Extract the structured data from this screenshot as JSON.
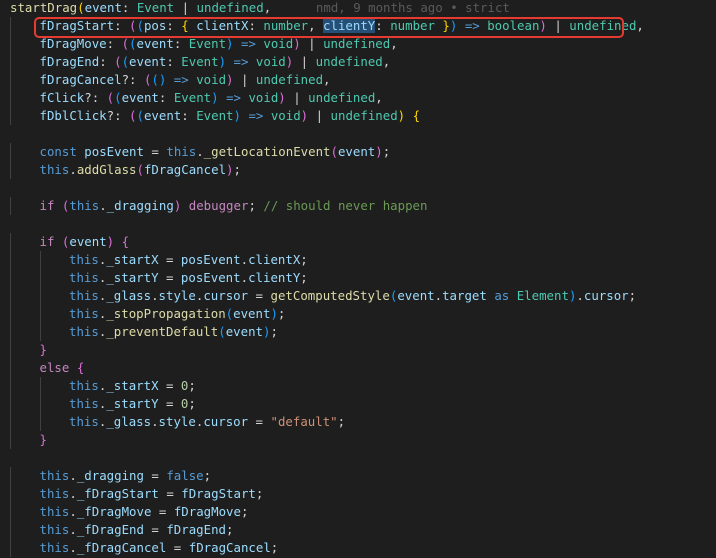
{
  "editor": {
    "lines": [
      {
        "indent": 0,
        "tokens": [
          {
            "t": "startDrag",
            "c": "fn"
          },
          {
            "t": "(",
            "c": "br"
          },
          {
            "t": "event",
            "c": "var"
          },
          {
            "t": ": ",
            "c": "op"
          },
          {
            "t": "Event",
            "c": "ty"
          },
          {
            "t": " | ",
            "c": "op"
          },
          {
            "t": "undefined",
            "c": "ty"
          },
          {
            "t": ",",
            "c": "op"
          },
          {
            "t": "      nmd, 9 months ago • strict",
            "c": "blame"
          }
        ]
      },
      {
        "indent": 1,
        "tokens": [
          {
            "t": "fDragStart",
            "c": "var"
          },
          {
            "t": ": ",
            "c": "op"
          },
          {
            "t": "(",
            "c": "br2"
          },
          {
            "t": "(",
            "c": "br3"
          },
          {
            "t": "pos",
            "c": "var"
          },
          {
            "t": ": ",
            "c": "op"
          },
          {
            "t": "{",
            "c": "br"
          },
          {
            "t": " ",
            "c": "op"
          },
          {
            "t": "clientX",
            "c": "var"
          },
          {
            "t": ": ",
            "c": "op"
          },
          {
            "t": "number",
            "c": "ty"
          },
          {
            "t": ", ",
            "c": "op"
          },
          {
            "t": "clientY",
            "c": "var",
            "hl": true
          },
          {
            "t": ": ",
            "c": "op"
          },
          {
            "t": "number",
            "c": "ty"
          },
          {
            "t": " ",
            "c": "op"
          },
          {
            "t": "}",
            "c": "br"
          },
          {
            "t": ")",
            "c": "br3"
          },
          {
            "t": " => ",
            "c": "kw"
          },
          {
            "t": "boolean",
            "c": "ty"
          },
          {
            "t": ")",
            "c": "br2"
          },
          {
            "t": " | ",
            "c": "op"
          },
          {
            "t": "undefined",
            "c": "ty"
          },
          {
            "t": ",",
            "c": "op"
          }
        ]
      },
      {
        "indent": 1,
        "tokens": [
          {
            "t": "fDragMove",
            "c": "var"
          },
          {
            "t": ": ",
            "c": "op"
          },
          {
            "t": "(",
            "c": "br2"
          },
          {
            "t": "(",
            "c": "br3"
          },
          {
            "t": "event",
            "c": "var"
          },
          {
            "t": ": ",
            "c": "op"
          },
          {
            "t": "Event",
            "c": "ty"
          },
          {
            "t": ")",
            "c": "br3"
          },
          {
            "t": " => ",
            "c": "kw"
          },
          {
            "t": "void",
            "c": "ty"
          },
          {
            "t": ")",
            "c": "br2"
          },
          {
            "t": " | ",
            "c": "op"
          },
          {
            "t": "undefined",
            "c": "ty"
          },
          {
            "t": ",",
            "c": "op"
          }
        ]
      },
      {
        "indent": 1,
        "tokens": [
          {
            "t": "fDragEnd",
            "c": "var"
          },
          {
            "t": ": ",
            "c": "op"
          },
          {
            "t": "(",
            "c": "br2"
          },
          {
            "t": "(",
            "c": "br3"
          },
          {
            "t": "event",
            "c": "var"
          },
          {
            "t": ": ",
            "c": "op"
          },
          {
            "t": "Event",
            "c": "ty"
          },
          {
            "t": ")",
            "c": "br3"
          },
          {
            "t": " => ",
            "c": "kw"
          },
          {
            "t": "void",
            "c": "ty"
          },
          {
            "t": ")",
            "c": "br2"
          },
          {
            "t": " | ",
            "c": "op"
          },
          {
            "t": "undefined",
            "c": "ty"
          },
          {
            "t": ",",
            "c": "op"
          }
        ]
      },
      {
        "indent": 1,
        "tokens": [
          {
            "t": "fDragCancel",
            "c": "var"
          },
          {
            "t": "?: ",
            "c": "op"
          },
          {
            "t": "(",
            "c": "br2"
          },
          {
            "t": "()",
            "c": "br3"
          },
          {
            "t": " => ",
            "c": "kw"
          },
          {
            "t": "void",
            "c": "ty"
          },
          {
            "t": ")",
            "c": "br2"
          },
          {
            "t": " | ",
            "c": "op"
          },
          {
            "t": "undefined",
            "c": "ty"
          },
          {
            "t": ",",
            "c": "op"
          }
        ]
      },
      {
        "indent": 1,
        "tokens": [
          {
            "t": "fClick",
            "c": "var"
          },
          {
            "t": "?: ",
            "c": "op"
          },
          {
            "t": "(",
            "c": "br2"
          },
          {
            "t": "(",
            "c": "br3"
          },
          {
            "t": "event",
            "c": "var"
          },
          {
            "t": ": ",
            "c": "op"
          },
          {
            "t": "Event",
            "c": "ty"
          },
          {
            "t": ")",
            "c": "br3"
          },
          {
            "t": " => ",
            "c": "kw"
          },
          {
            "t": "void",
            "c": "ty"
          },
          {
            "t": ")",
            "c": "br2"
          },
          {
            "t": " | ",
            "c": "op"
          },
          {
            "t": "undefined",
            "c": "ty"
          },
          {
            "t": ",",
            "c": "op"
          }
        ]
      },
      {
        "indent": 1,
        "tokens": [
          {
            "t": "fDblClick",
            "c": "var"
          },
          {
            "t": "?: ",
            "c": "op"
          },
          {
            "t": "(",
            "c": "br2"
          },
          {
            "t": "(",
            "c": "br3"
          },
          {
            "t": "event",
            "c": "var"
          },
          {
            "t": ": ",
            "c": "op"
          },
          {
            "t": "Event",
            "c": "ty"
          },
          {
            "t": ")",
            "c": "br3"
          },
          {
            "t": " => ",
            "c": "kw"
          },
          {
            "t": "void",
            "c": "ty"
          },
          {
            "t": ")",
            "c": "br2"
          },
          {
            "t": " | ",
            "c": "op"
          },
          {
            "t": "undefined",
            "c": "ty"
          },
          {
            "t": ")",
            "c": "br"
          },
          {
            "t": " ",
            "c": "op"
          },
          {
            "t": "{",
            "c": "br"
          }
        ]
      },
      {
        "indent": 0,
        "tokens": []
      },
      {
        "indent": 1,
        "tokens": [
          {
            "t": "const",
            "c": "kw"
          },
          {
            "t": " ",
            "c": "op"
          },
          {
            "t": "posEvent",
            "c": "var"
          },
          {
            "t": " = ",
            "c": "op"
          },
          {
            "t": "this",
            "c": "kw"
          },
          {
            "t": ".",
            "c": "op"
          },
          {
            "t": "_getLocationEvent",
            "c": "fn"
          },
          {
            "t": "(",
            "c": "br2"
          },
          {
            "t": "event",
            "c": "var"
          },
          {
            "t": ")",
            "c": "br2"
          },
          {
            "t": ";",
            "c": "op"
          }
        ]
      },
      {
        "indent": 1,
        "tokens": [
          {
            "t": "this",
            "c": "kw"
          },
          {
            "t": ".",
            "c": "op"
          },
          {
            "t": "addGlass",
            "c": "fn"
          },
          {
            "t": "(",
            "c": "br2"
          },
          {
            "t": "fDragCancel",
            "c": "var"
          },
          {
            "t": ")",
            "c": "br2"
          },
          {
            "t": ";",
            "c": "op"
          }
        ]
      },
      {
        "indent": 0,
        "tokens": []
      },
      {
        "indent": 1,
        "tokens": [
          {
            "t": "if",
            "c": "ctl"
          },
          {
            "t": " ",
            "c": "op"
          },
          {
            "t": "(",
            "c": "br2"
          },
          {
            "t": "this",
            "c": "kw"
          },
          {
            "t": ".",
            "c": "op"
          },
          {
            "t": "_dragging",
            "c": "var"
          },
          {
            "t": ")",
            "c": "br2"
          },
          {
            "t": " ",
            "c": "op"
          },
          {
            "t": "debugger",
            "c": "ctl"
          },
          {
            "t": "; ",
            "c": "op"
          },
          {
            "t": "// should never happen",
            "c": "cmt"
          }
        ]
      },
      {
        "indent": 0,
        "tokens": []
      },
      {
        "indent": 1,
        "tokens": [
          {
            "t": "if",
            "c": "ctl"
          },
          {
            "t": " ",
            "c": "op"
          },
          {
            "t": "(",
            "c": "br2"
          },
          {
            "t": "event",
            "c": "var"
          },
          {
            "t": ")",
            "c": "br2"
          },
          {
            "t": " ",
            "c": "op"
          },
          {
            "t": "{",
            "c": "br2"
          }
        ]
      },
      {
        "indent": 2,
        "tokens": [
          {
            "t": "this",
            "c": "kw"
          },
          {
            "t": ".",
            "c": "op"
          },
          {
            "t": "_startX",
            "c": "var"
          },
          {
            "t": " = ",
            "c": "op"
          },
          {
            "t": "posEvent",
            "c": "var"
          },
          {
            "t": ".",
            "c": "op"
          },
          {
            "t": "clientX",
            "c": "var"
          },
          {
            "t": ";",
            "c": "op"
          }
        ]
      },
      {
        "indent": 2,
        "tokens": [
          {
            "t": "this",
            "c": "kw"
          },
          {
            "t": ".",
            "c": "op"
          },
          {
            "t": "_startY",
            "c": "var"
          },
          {
            "t": " = ",
            "c": "op"
          },
          {
            "t": "posEvent",
            "c": "var"
          },
          {
            "t": ".",
            "c": "op"
          },
          {
            "t": "clientY",
            "c": "var"
          },
          {
            "t": ";",
            "c": "op"
          }
        ]
      },
      {
        "indent": 2,
        "tokens": [
          {
            "t": "this",
            "c": "kw"
          },
          {
            "t": ".",
            "c": "op"
          },
          {
            "t": "_glass",
            "c": "var"
          },
          {
            "t": ".",
            "c": "op"
          },
          {
            "t": "style",
            "c": "var"
          },
          {
            "t": ".",
            "c": "op"
          },
          {
            "t": "cursor",
            "c": "var"
          },
          {
            "t": " = ",
            "c": "op"
          },
          {
            "t": "getComputedStyle",
            "c": "fn"
          },
          {
            "t": "(",
            "c": "br3"
          },
          {
            "t": "event",
            "c": "var"
          },
          {
            "t": ".",
            "c": "op"
          },
          {
            "t": "target",
            "c": "var"
          },
          {
            "t": " ",
            "c": "op"
          },
          {
            "t": "as",
            "c": "kw"
          },
          {
            "t": " ",
            "c": "op"
          },
          {
            "t": "Element",
            "c": "ty"
          },
          {
            "t": ")",
            "c": "br3"
          },
          {
            "t": ".",
            "c": "op"
          },
          {
            "t": "cursor",
            "c": "var"
          },
          {
            "t": ";",
            "c": "op"
          }
        ]
      },
      {
        "indent": 2,
        "tokens": [
          {
            "t": "this",
            "c": "kw"
          },
          {
            "t": ".",
            "c": "op"
          },
          {
            "t": "_stopPropagation",
            "c": "fn"
          },
          {
            "t": "(",
            "c": "br3"
          },
          {
            "t": "event",
            "c": "var"
          },
          {
            "t": ")",
            "c": "br3"
          },
          {
            "t": ";",
            "c": "op"
          }
        ]
      },
      {
        "indent": 2,
        "tokens": [
          {
            "t": "this",
            "c": "kw"
          },
          {
            "t": ".",
            "c": "op"
          },
          {
            "t": "_preventDefault",
            "c": "fn"
          },
          {
            "t": "(",
            "c": "br3"
          },
          {
            "t": "event",
            "c": "var"
          },
          {
            "t": ")",
            "c": "br3"
          },
          {
            "t": ";",
            "c": "op"
          }
        ]
      },
      {
        "indent": 1,
        "tokens": [
          {
            "t": "}",
            "c": "br2"
          }
        ]
      },
      {
        "indent": 1,
        "tokens": [
          {
            "t": "else",
            "c": "ctl"
          },
          {
            "t": " ",
            "c": "op"
          },
          {
            "t": "{",
            "c": "br2"
          }
        ]
      },
      {
        "indent": 2,
        "tokens": [
          {
            "t": "this",
            "c": "kw"
          },
          {
            "t": ".",
            "c": "op"
          },
          {
            "t": "_startX",
            "c": "var"
          },
          {
            "t": " = ",
            "c": "op"
          },
          {
            "t": "0",
            "c": "num"
          },
          {
            "t": ";",
            "c": "op"
          }
        ]
      },
      {
        "indent": 2,
        "tokens": [
          {
            "t": "this",
            "c": "kw"
          },
          {
            "t": ".",
            "c": "op"
          },
          {
            "t": "_startY",
            "c": "var"
          },
          {
            "t": " = ",
            "c": "op"
          },
          {
            "t": "0",
            "c": "num"
          },
          {
            "t": ";",
            "c": "op"
          }
        ]
      },
      {
        "indent": 2,
        "tokens": [
          {
            "t": "this",
            "c": "kw"
          },
          {
            "t": ".",
            "c": "op"
          },
          {
            "t": "_glass",
            "c": "var"
          },
          {
            "t": ".",
            "c": "op"
          },
          {
            "t": "style",
            "c": "var"
          },
          {
            "t": ".",
            "c": "op"
          },
          {
            "t": "cursor",
            "c": "var"
          },
          {
            "t": " = ",
            "c": "op"
          },
          {
            "t": "\"default\"",
            "c": "str"
          },
          {
            "t": ";",
            "c": "op"
          }
        ]
      },
      {
        "indent": 1,
        "tokens": [
          {
            "t": "}",
            "c": "br2"
          }
        ]
      },
      {
        "indent": 0,
        "tokens": []
      },
      {
        "indent": 1,
        "tokens": [
          {
            "t": "this",
            "c": "kw"
          },
          {
            "t": ".",
            "c": "op"
          },
          {
            "t": "_dragging",
            "c": "var"
          },
          {
            "t": " = ",
            "c": "op"
          },
          {
            "t": "false",
            "c": "kw"
          },
          {
            "t": ";",
            "c": "op"
          }
        ]
      },
      {
        "indent": 1,
        "tokens": [
          {
            "t": "this",
            "c": "kw"
          },
          {
            "t": ".",
            "c": "op"
          },
          {
            "t": "_fDragStart",
            "c": "var"
          },
          {
            "t": " = ",
            "c": "op"
          },
          {
            "t": "fDragStart",
            "c": "var"
          },
          {
            "t": ";",
            "c": "op"
          }
        ]
      },
      {
        "indent": 1,
        "tokens": [
          {
            "t": "this",
            "c": "kw"
          },
          {
            "t": ".",
            "c": "op"
          },
          {
            "t": "_fDragMove",
            "c": "var"
          },
          {
            "t": " = ",
            "c": "op"
          },
          {
            "t": "fDragMove",
            "c": "var"
          },
          {
            "t": ";",
            "c": "op"
          }
        ]
      },
      {
        "indent": 1,
        "tokens": [
          {
            "t": "this",
            "c": "kw"
          },
          {
            "t": ".",
            "c": "op"
          },
          {
            "t": "_fDragEnd",
            "c": "var"
          },
          {
            "t": " = ",
            "c": "op"
          },
          {
            "t": "fDragEnd",
            "c": "var"
          },
          {
            "t": ";",
            "c": "op"
          }
        ]
      },
      {
        "indent": 1,
        "tokens": [
          {
            "t": "this",
            "c": "kw"
          },
          {
            "t": ".",
            "c": "op"
          },
          {
            "t": "_fDragCancel",
            "c": "var"
          },
          {
            "t": " = ",
            "c": "op"
          },
          {
            "t": "fDragCancel",
            "c": "var"
          },
          {
            "t": ";",
            "c": "op"
          }
        ]
      }
    ],
    "highlighted_line": 1
  }
}
